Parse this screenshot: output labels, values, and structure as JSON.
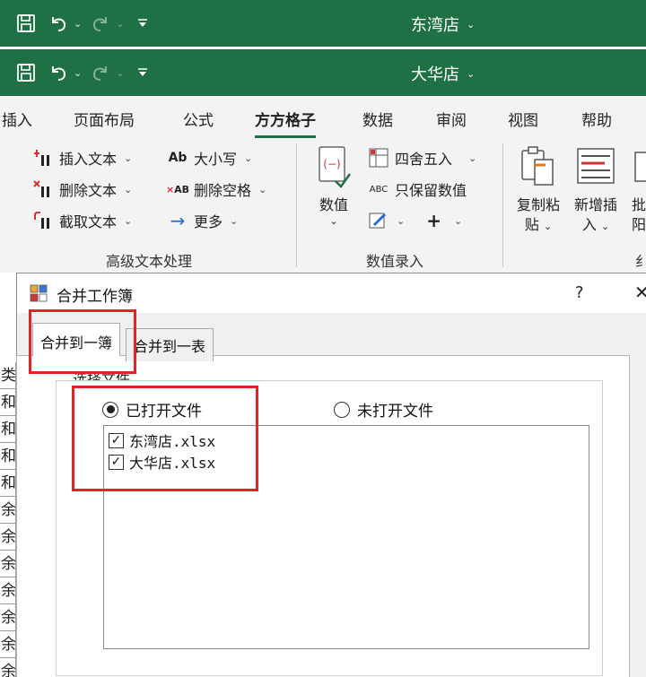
{
  "windows": [
    {
      "title": "东湾店",
      "caret": "⌄"
    },
    {
      "title": "大华店",
      "caret": "⌄"
    }
  ],
  "ribbon_tabs": [
    "插入",
    "页面布局",
    "公式",
    "方方格子",
    "数据",
    "审阅",
    "视图",
    "帮助"
  ],
  "active_tab": "方方格子",
  "ribbon": {
    "text_group": {
      "label": "高级文本处理",
      "insert_text": "插入文本",
      "delete_text": "删除文本",
      "extract_text": "截取文本",
      "case": "大小写",
      "case_icon_text": "Ab",
      "remove_spaces": "删除空格",
      "remove_spaces_icon_text": "AB",
      "more": "更多"
    },
    "number_group": {
      "label": "数值录入",
      "value_btn": "数值",
      "round": "四舍五入",
      "keep_values": "只保留数值",
      "keep_values_icon_text": "ABC",
      "plus": "+"
    },
    "paste_group": {
      "copy_paste_line1": "复制粘",
      "copy_paste_line2": "贴",
      "add_insert_line1": "新增插",
      "add_insert_line2": "入",
      "batch_partial_line1": "批",
      "batch_partial_line2": "阳",
      "cut_label": "纟"
    }
  },
  "sheet_cells": [
    "类",
    "和",
    "和",
    "和",
    "和",
    "余",
    "余",
    "余",
    "余",
    "余",
    "余",
    "余"
  ],
  "dialog": {
    "title": "合并工作簿",
    "help": "?",
    "close": "✕",
    "tabs": [
      "合并到一簿",
      "合并到一表"
    ],
    "groupbox_label": "选择文件",
    "radio_open": "已打开文件",
    "radio_closed": "未打开文件",
    "files": [
      "东湾店.xlsx",
      "大华店.xlsx"
    ]
  },
  "colors": {
    "excel_green": "#1f7145",
    "highlight_red": "#e0242a"
  }
}
